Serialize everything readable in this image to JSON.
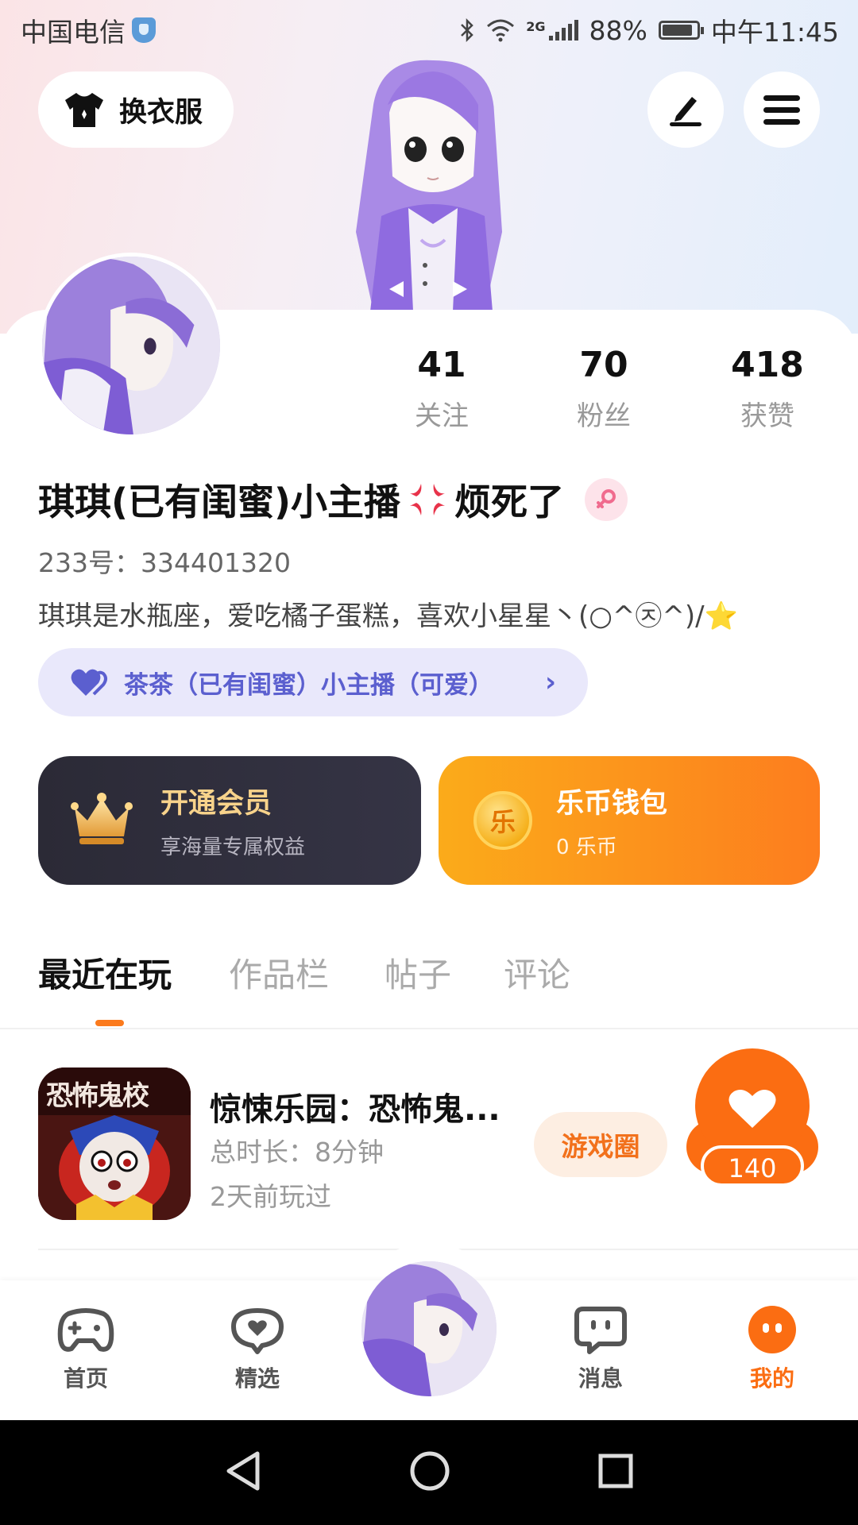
{
  "status_bar": {
    "carrier": "中国电信",
    "network": "2G",
    "battery": "88%",
    "battery_level": 0.88,
    "time": "中午11:45"
  },
  "header": {
    "outfit_button_label": "换衣服"
  },
  "stats": [
    {
      "value": "41",
      "label": "关注"
    },
    {
      "value": "70",
      "label": "粉丝"
    },
    {
      "value": "418",
      "label": "获赞"
    }
  ],
  "profile": {
    "name_part1": "琪琪(已有闺蜜)小主播",
    "name_part2": "烦死了",
    "id_text": "233号：334401320",
    "bio": "琪琪是水瓶座，爱吃橘子蛋糕，喜欢小星星丶(○^㉨^)/",
    "bio_emoji": "⭐",
    "relation_label": "茶茶（已有闺蜜）小主播（可爱）"
  },
  "vip": {
    "title": "开通会员",
    "subtitle": "享海量专属权益"
  },
  "wallet": {
    "title": "乐币钱包",
    "subtitle": "0 乐币",
    "coin_glyph": "乐"
  },
  "tabs": [
    {
      "label": "最近在玩",
      "active": true
    },
    {
      "label": "作品栏",
      "active": false
    },
    {
      "label": "帖子",
      "active": false
    },
    {
      "label": "评论",
      "active": false
    }
  ],
  "games": [
    {
      "icon_text": "恐怖鬼校",
      "title": "惊悚乐园：恐怖鬼...",
      "duration": "总时长：8分钟",
      "last_played": "2天前玩过",
      "circle_button": "游戏圈",
      "likes": "140"
    }
  ],
  "bottom_nav": [
    {
      "label": "首页",
      "icon": "gamepad-icon",
      "active": false
    },
    {
      "label": "精选",
      "icon": "heart-chat-icon",
      "active": false
    },
    {
      "label": "消息",
      "icon": "chat-bubble-icon",
      "active": false
    },
    {
      "label": "我的",
      "icon": "profile-dots-icon",
      "active": true
    }
  ],
  "colors": {
    "accent": "#fb7a1c",
    "vip_gold": "#f8d38b",
    "relation_purple": "#5b5fcf"
  }
}
